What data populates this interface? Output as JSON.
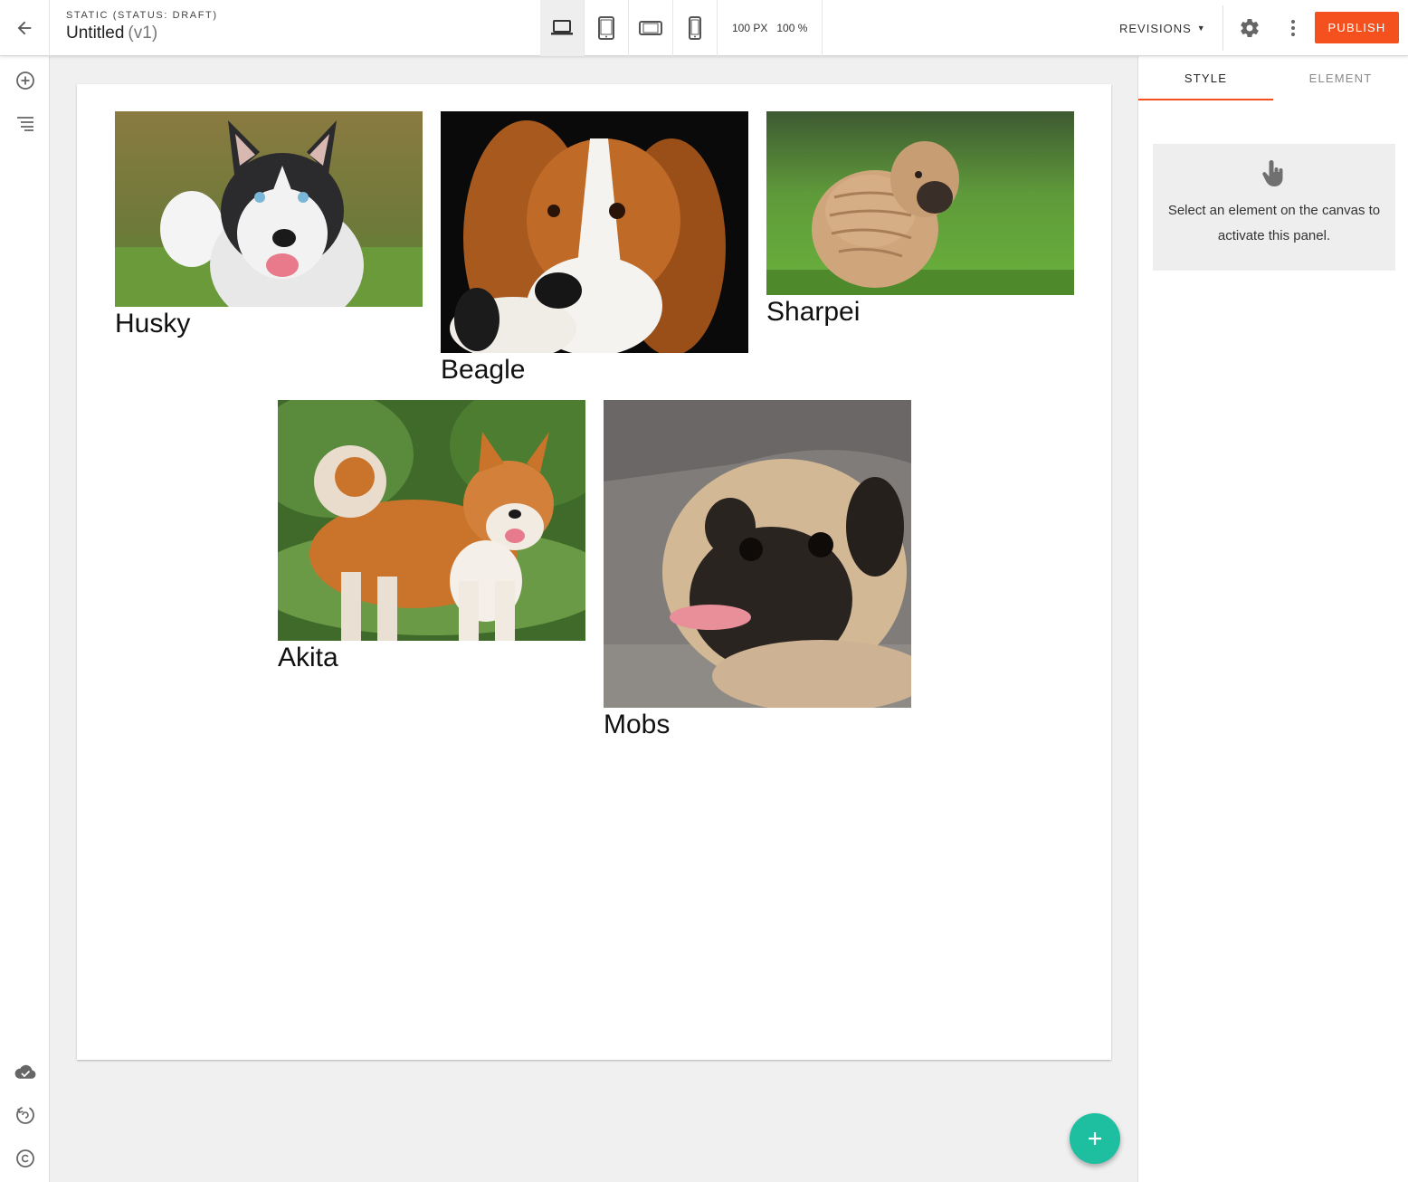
{
  "header": {
    "status": "STATIC (STATUS: DRAFT)",
    "title": "Untitled",
    "version": "(v1)",
    "zoom_px": "100 PX",
    "zoom_percent": "100 %",
    "revisions_label": "REVISIONS",
    "publish_label": "PUBLISH"
  },
  "devices": [
    "laptop-icon",
    "tablet-icon",
    "tablet-landscape-icon",
    "phone-icon"
  ],
  "leftrail": {
    "top": [
      "add-circle-icon",
      "outline-list-icon"
    ],
    "bottom": [
      "cloud-done-icon",
      "undo-icon",
      "redo-icon"
    ]
  },
  "canvas": {
    "cards": [
      {
        "caption": "Husky"
      },
      {
        "caption": "Beagle"
      },
      {
        "caption": "Sharpei"
      },
      {
        "caption": "Akita"
      },
      {
        "caption": "Mobs"
      }
    ]
  },
  "panel": {
    "tabs": [
      {
        "label": "STYLE"
      },
      {
        "label": "ELEMENT"
      }
    ],
    "hint": "Select an element on the canvas to activate this panel."
  },
  "colors": {
    "accent": "#f4511e",
    "fab": "#1dbfa0"
  }
}
